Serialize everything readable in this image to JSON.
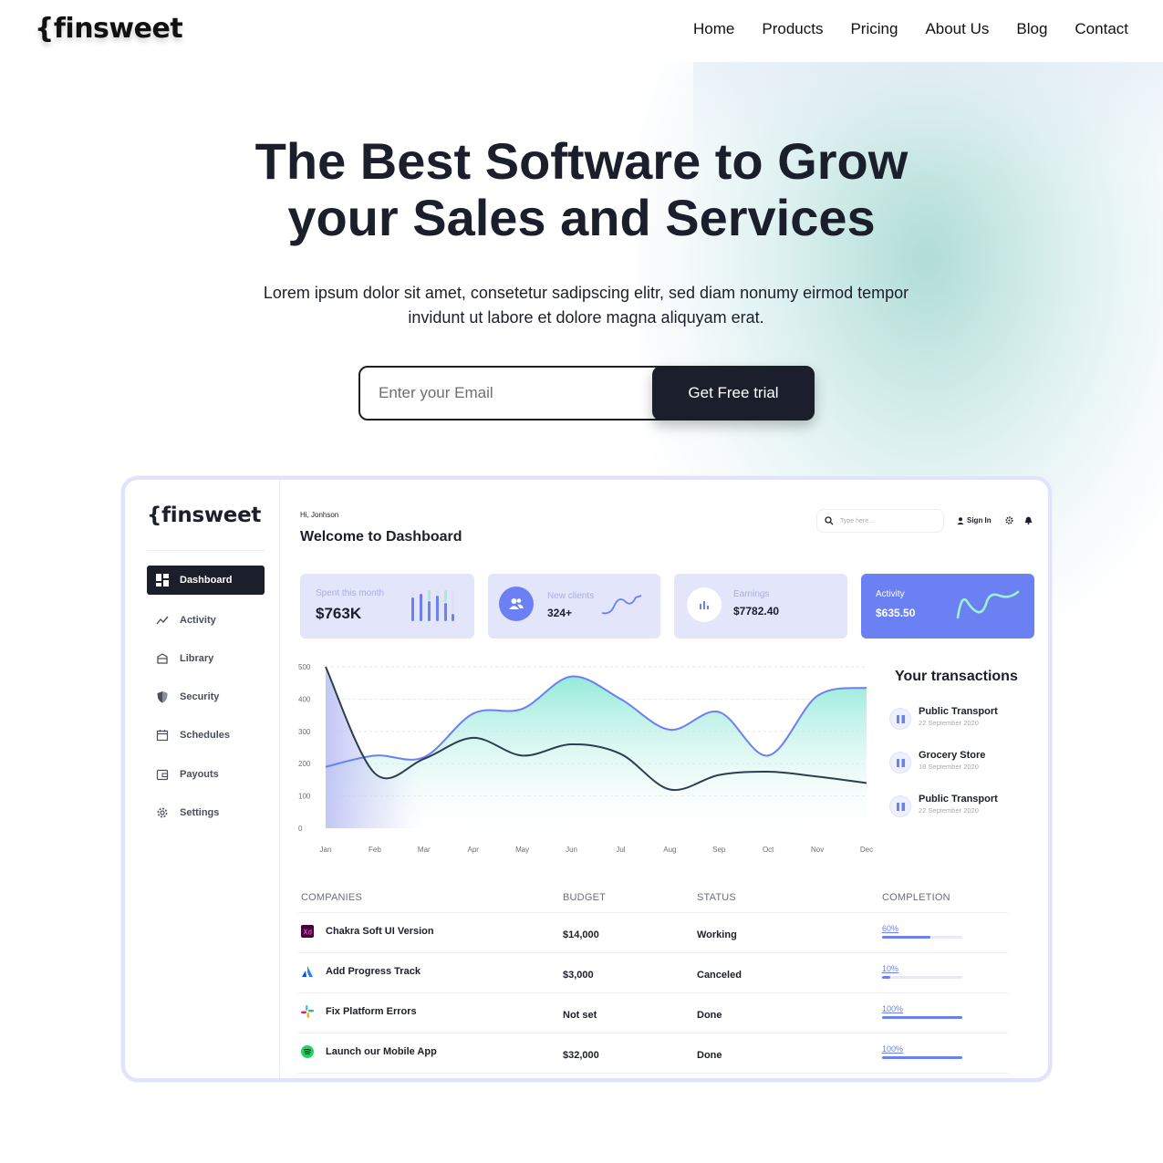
{
  "site": {
    "logo": "{finsweet"
  },
  "nav": [
    "Home",
    "Products",
    "Pricing",
    "About Us",
    "Blog",
    "Contact"
  ],
  "hero": {
    "title_line1": "The Best Software to Grow",
    "title_line2": "your Sales and Services",
    "subtitle_line1": "Lorem ipsum dolor sit amet, consetetur sadipscing elitr, sed diam nonumy eirmod tempor",
    "subtitle_line2": "invidunt ut labore et dolore magna aliquyam erat.",
    "email_placeholder": "Enter your Email",
    "cta_label": "Get Free trial"
  },
  "dashboard": {
    "logo": "{finsweet",
    "greeting": "Hi, Jonhson",
    "title": "Welcome to Dashboard",
    "search_placeholder": "Type here...",
    "sign_in": "Sign In",
    "sidebar": [
      "Dashboard",
      "Activity",
      "Library",
      "Security",
      "Schedules",
      "Payouts",
      "Settings"
    ],
    "cards": [
      {
        "label": "Spent this month",
        "value": "$763K"
      },
      {
        "label": "New clients",
        "value": "324+"
      },
      {
        "label": "Earnings",
        "value": "$7782.40"
      },
      {
        "label": "Activity",
        "value": "$635.50"
      }
    ],
    "transactions_title": "Your transactions",
    "transactions": [
      {
        "name": "Public Transport",
        "date": "22 September 2020"
      },
      {
        "name": "Grocery Store",
        "date": "18 September 2020"
      },
      {
        "name": "Public Transport",
        "date": "22 September 2020"
      }
    ],
    "table": {
      "headers": [
        "COMPANIES",
        "BUDGET",
        "STATUS",
        "COMPLETION"
      ],
      "rows": [
        {
          "company": "Chakra Soft UI Version",
          "budget": "$14,000",
          "status": "Working",
          "completion": "60%",
          "fraction": 0.6
        },
        {
          "company": "Add Progress Track",
          "budget": "$3,000",
          "status": "Canceled",
          "completion": "10%",
          "fraction": 0.1
        },
        {
          "company": "Fix Platform Errors",
          "budget": "Not set",
          "status": "Done",
          "completion": "100%",
          "fraction": 1.0
        },
        {
          "company": "Launch our Mobile App",
          "budget": "$32,000",
          "status": "Done",
          "completion": "100%",
          "fraction": 1.0
        }
      ]
    }
  },
  "chart_data": {
    "type": "area",
    "categories": [
      "Jan",
      "Feb",
      "Mar",
      "Apr",
      "May",
      "Jun",
      "Jul",
      "Aug",
      "Sep",
      "Oct",
      "Nov",
      "Dec"
    ],
    "yticks": [
      500,
      400,
      300,
      200,
      100,
      0
    ],
    "ylim": [
      0,
      500
    ],
    "series": [
      {
        "values": [
          190,
          225,
          220,
          355,
          370,
          470,
          400,
          305,
          360,
          225,
          410,
          435
        ],
        "color": "#6b80f3"
      },
      {
        "values": [
          500,
          170,
          215,
          280,
          225,
          260,
          230,
          120,
          165,
          175,
          160,
          140
        ],
        "color": "#2d3e50"
      }
    ],
    "grid": true
  }
}
